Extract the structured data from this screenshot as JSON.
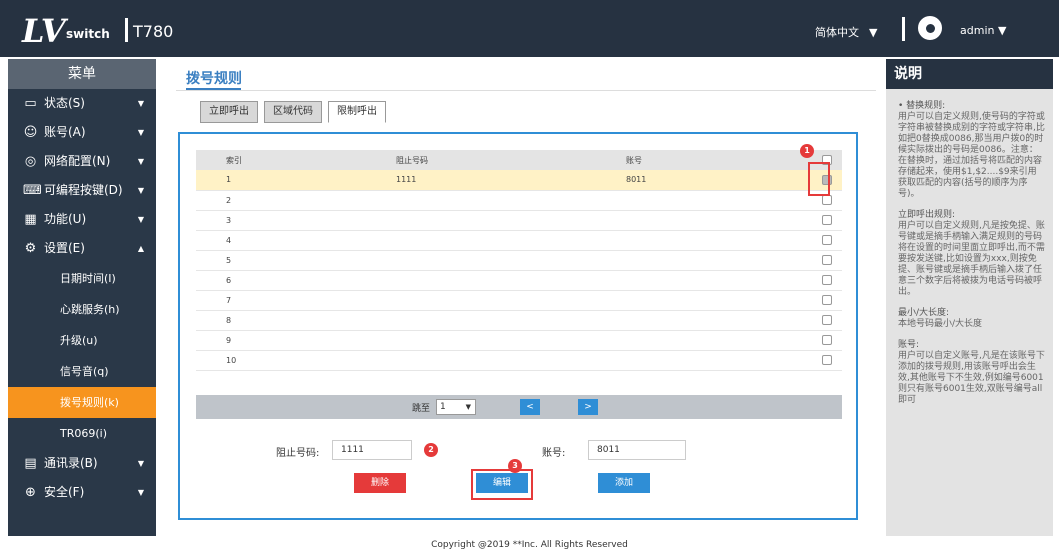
{
  "header": {
    "logo_text": "LV",
    "logo_sub": "switch",
    "model": "T780",
    "language": "简体中文",
    "user": "admin"
  },
  "sidebar": {
    "title": "菜单",
    "items": [
      {
        "label": "状态(S)",
        "icon": "monitor-icon",
        "arrow": "▼"
      },
      {
        "label": "账号(A)",
        "icon": "user-icon",
        "arrow": "▼"
      },
      {
        "label": "网络配置(N)",
        "icon": "globe-icon",
        "arrow": "▼"
      },
      {
        "label": "可编程按键(D)",
        "icon": "keyboard-icon",
        "arrow": "▼"
      },
      {
        "label": "功能(U)",
        "icon": "grid-icon",
        "arrow": "▼"
      },
      {
        "label": "设置(E)",
        "icon": "gear-icon",
        "arrow": "▲"
      }
    ],
    "sub_items": [
      "日期时间(I)",
      "心跳服务(h)",
      "升级(u)",
      "信号音(q)",
      "拨号规则(k)",
      "TR069(i)"
    ],
    "active_sub": "拨号规则(k)",
    "bottom_items": [
      {
        "label": "通讯录(B)",
        "icon": "book-icon",
        "arrow": "▼"
      },
      {
        "label": "安全(F)",
        "icon": "shield-icon",
        "arrow": "▼"
      }
    ]
  },
  "main": {
    "title": "拨号规则",
    "tabs": [
      "立即呼出",
      "区域代码",
      "限制呼出"
    ],
    "active_tab": "限制呼出",
    "table": {
      "headers": [
        "索引",
        "阻止号码",
        "账号"
      ],
      "rows": [
        {
          "index": "1",
          "number": "1111",
          "account": "8011",
          "selected": true
        },
        {
          "index": "2",
          "number": "",
          "account": "",
          "selected": false
        },
        {
          "index": "3",
          "number": "",
          "account": "",
          "selected": false
        },
        {
          "index": "4",
          "number": "",
          "account": "",
          "selected": false
        },
        {
          "index": "5",
          "number": "",
          "account": "",
          "selected": false
        },
        {
          "index": "6",
          "number": "",
          "account": "",
          "selected": false
        },
        {
          "index": "7",
          "number": "",
          "account": "",
          "selected": false
        },
        {
          "index": "8",
          "number": "",
          "account": "",
          "selected": false
        },
        {
          "index": "9",
          "number": "",
          "account": "",
          "selected": false
        },
        {
          "index": "10",
          "number": "",
          "account": "",
          "selected": false
        }
      ]
    },
    "pager": {
      "label": "跳至",
      "page": "1",
      "prev": "<",
      "next": ">"
    },
    "form": {
      "number_label": "阻止号码:",
      "number_value": "1111",
      "account_label": "账号:",
      "account_value": "8011"
    },
    "buttons": {
      "delete": "删除",
      "edit": "编辑",
      "add": "添加"
    },
    "badges": [
      "1",
      "2",
      "3"
    ]
  },
  "help": {
    "title": "说明",
    "sections": [
      {
        "title": "• 替换规则:",
        "body": "用户可以自定义规则,使号码的字符或字符串被替换成别的字符或字符串,比如把0替换成0086,那当用户拨0的时候实际拨出的号码是0086。注意：在替换时，通过加括号将匹配的内容存储起来，使用$1,$2....$9来引用获取匹配的内容(括号的顺序为序号)。"
      },
      {
        "title": "立即呼出规则:",
        "body": "用户可以自定义规则,凡是按免提、账号键或是摘手柄输入满足规则的号码将在设置的时间里面立即呼出,而不需要按发送键,比如设置为xxx,则按免提、账号键或是摘手柄后输入拨了任意三个数字后将被拨为电话号码被呼出。"
      },
      {
        "title": "最小/大长度:",
        "body": "本地号码最小/大长度"
      },
      {
        "title": "账号:",
        "body": "用户可以自定义账号,凡是在该账号下添加的拨号规则,用该账号呼出会生效,其他账号下不生效,例如编号6001则只有账号6001生效,双账号编号all即可"
      }
    ]
  },
  "footer": "Copyright @2019 **Inc. All Rights Reserved",
  "colors": {
    "accent": "#2f8ed6",
    "active": "#f7941e",
    "danger": "#e53a3a",
    "header": "#263241",
    "sidebar": "#2a3848"
  }
}
